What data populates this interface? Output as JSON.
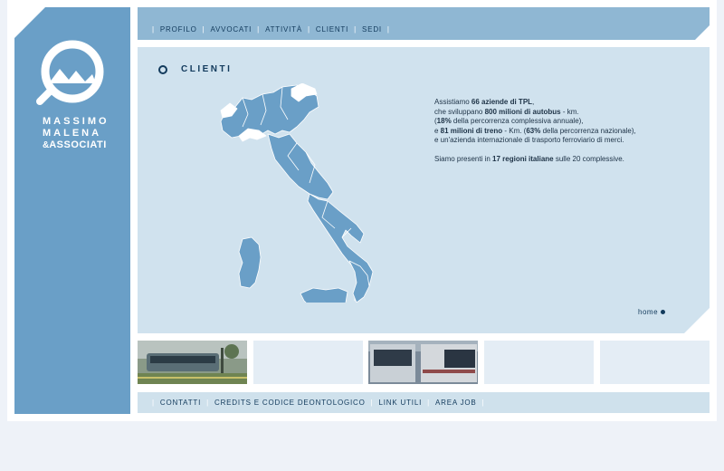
{
  "brand": {
    "line1": "MASSIMO",
    "line2": "MALENA",
    "line3_amp": "&",
    "line3": "ASSOCIATI"
  },
  "nav": {
    "items": [
      "PROFILO",
      "AVVOCATI",
      "ATTIVITÀ",
      "CLIENTI",
      "SEDI"
    ],
    "separator": "|"
  },
  "section": {
    "title": "CLIENTI"
  },
  "info": {
    "p1": {
      "a": "Assistiamo ",
      "b": "66 aziende di TPL",
      "c": ","
    },
    "p2": {
      "a": "che sviluppano ",
      "b": "800 milioni di autobus",
      "c": " - km."
    },
    "p3": {
      "a": "(",
      "b": "18%",
      "c": " della percorrenza complessiva annuale),"
    },
    "p4": {
      "a": "e ",
      "b": "81 milioni di treno",
      "c": " - Km. (",
      "d": "63%",
      "e": " della percorrenza nazionale),"
    },
    "p5": "e un'azienda internazionale di trasporto ferroviario di merci.",
    "p6": {
      "a": "Siamo presenti in ",
      "b": "17 regioni italiane",
      "c": " sulle 20 complessive."
    }
  },
  "home_link": "home",
  "footer": {
    "items": [
      "CONTATTI",
      "CREDITS E CODICE DEONTOLOGICO",
      "LINK UTILI",
      "AREA JOB"
    ],
    "separator": "|"
  },
  "colors": {
    "sidebar": "#6a9fc7",
    "nav_bg": "#8fb7d3",
    "content_bg": "#d0e2ee",
    "map_fill": "#6a9fc7",
    "text_dark": "#123a5c"
  }
}
